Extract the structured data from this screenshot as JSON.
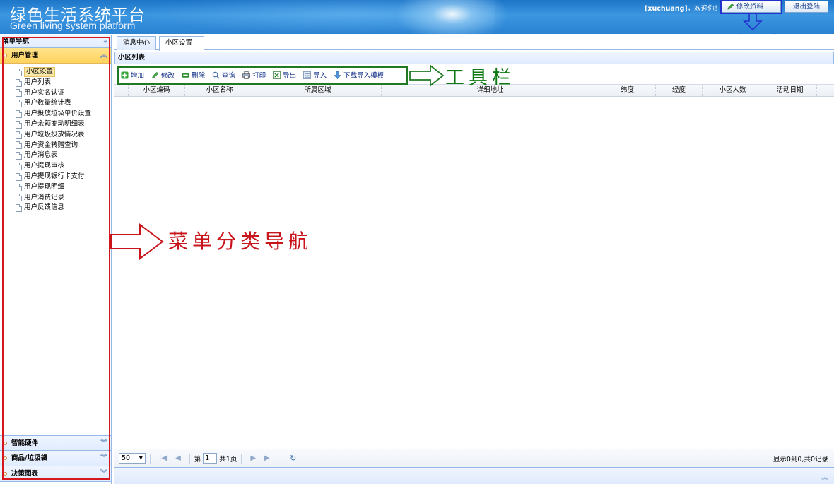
{
  "header": {
    "title_cn": "绿色生活系统平台",
    "title_en": "Green living system platform",
    "welcome_user": "[xuchuang]",
    "welcome_text": "，欢迎你！",
    "edit_profile_label": "修改资料",
    "logout_label": "退出登陆"
  },
  "sidebar": {
    "title": "菜单导航",
    "sections": [
      {
        "label": "用户管理",
        "expanded": true
      },
      {
        "label": "智能硬件",
        "expanded": false
      },
      {
        "label": "商品/垃圾袋",
        "expanded": false
      },
      {
        "label": "决策图表",
        "expanded": false
      }
    ],
    "items": [
      {
        "label": "小区设置",
        "selected": true
      },
      {
        "label": "用户列表"
      },
      {
        "label": "用户实名认证"
      },
      {
        "label": "用户数量统计表"
      },
      {
        "label": "用户投放垃圾单价设置"
      },
      {
        "label": "用户余额变动明细表"
      },
      {
        "label": "用户垃圾投放情况表"
      },
      {
        "label": "用户资金转赠查询"
      },
      {
        "label": "用户消息表"
      },
      {
        "label": "用户提现审核"
      },
      {
        "label": "用户提现银行卡支付"
      },
      {
        "label": "用户提现明细"
      },
      {
        "label": "用户消费记录"
      },
      {
        "label": "用户反馈信息"
      }
    ]
  },
  "tabs": [
    {
      "label": "消息中心",
      "closable": false
    },
    {
      "label": "小区设置",
      "closable": true,
      "close_glyph": "×"
    }
  ],
  "panel": {
    "title": "小区列表"
  },
  "toolbar": [
    {
      "label": "增加",
      "icon": "add-icon"
    },
    {
      "label": "修改",
      "icon": "edit-icon"
    },
    {
      "label": "删除",
      "icon": "delete-icon"
    },
    {
      "label": "查询",
      "icon": "search-icon"
    },
    {
      "label": "打印",
      "icon": "print-icon"
    },
    {
      "label": "导出",
      "icon": "export-icon"
    },
    {
      "label": "导入",
      "icon": "import-icon"
    },
    {
      "label": "下载导入模板",
      "icon": "download-icon"
    }
  ],
  "grid": {
    "columns": [
      "小区编码",
      "小区名称",
      "所属区域",
      "详细地址",
      "纬度",
      "经度",
      "小区人数",
      "活动日期"
    ],
    "rows": []
  },
  "pager": {
    "page_size": "50",
    "page_prefix": "第",
    "page_value": "1",
    "page_suffix": "共1页",
    "info": "显示0到0,共0记录"
  },
  "annotations": {
    "toolbar_note": "工具栏",
    "menu_note": "菜单分类导航",
    "password_note": "修改账户登陆密码"
  },
  "colors": {
    "header_blue": "#2a82d2",
    "border_blue": "#95b8e7",
    "active_section": "#ffd35e",
    "annotation_red": "#c8141b",
    "annotation_green": "#0f7a14",
    "annotation_blue": "#1a45b5"
  }
}
